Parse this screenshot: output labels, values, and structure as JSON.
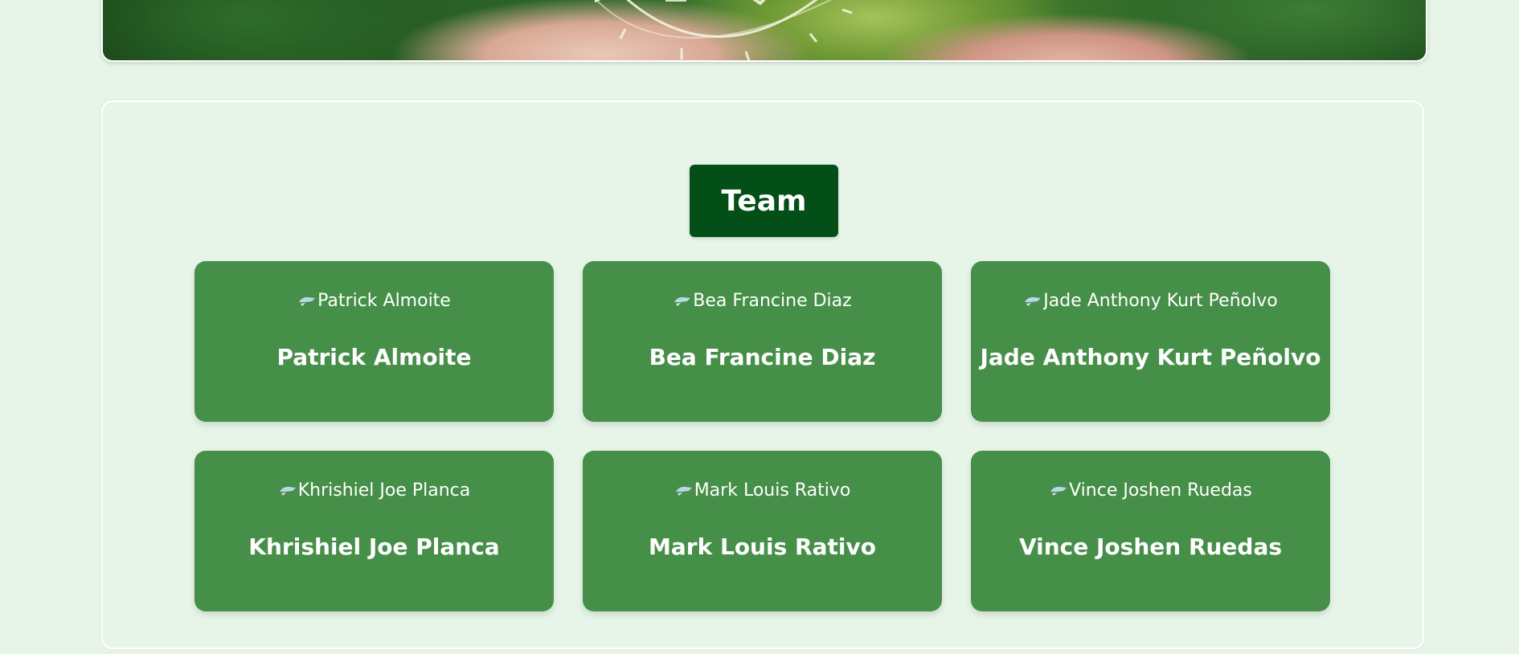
{
  "team": {
    "title": "Team",
    "members": [
      {
        "photo_alt": "Patrick Almoite",
        "name": "Patrick Almoite"
      },
      {
        "photo_alt": "Bea Francine Diaz",
        "name": "Bea Francine Diaz"
      },
      {
        "photo_alt": "Jade Anthony Kurt Peñolvo",
        "name": "Jade Anthony Kurt Peñolvo"
      },
      {
        "photo_alt": "Khrishiel Joe Planca",
        "name": "Khrishiel Joe Planca"
      },
      {
        "photo_alt": "Mark Louis Rativo",
        "name": "Mark Louis Rativo"
      },
      {
        "photo_alt": "Vince Joshen Ruedas",
        "name": "Vince Joshen Ruedas"
      }
    ]
  },
  "colors": {
    "page_background": "#e7f5e9",
    "title_background": "#034f17",
    "card_background": "#468f48",
    "text": "#ffffff"
  },
  "icons": {
    "hero": "gear-globe-in-hands-icon",
    "photo": "broken-image-icon"
  }
}
